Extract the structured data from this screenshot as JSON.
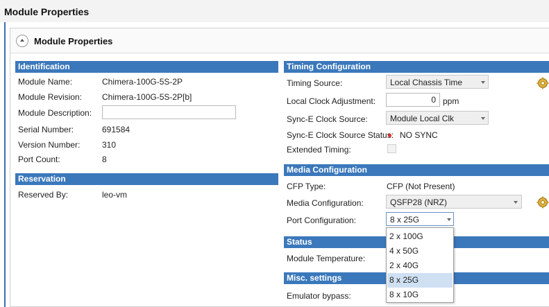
{
  "page_title": "Module Properties",
  "panel_title": "Module Properties",
  "identification": {
    "header": "Identification",
    "module_name": {
      "label": "Module Name:",
      "value": "Chimera-100G-5S-2P"
    },
    "module_revision": {
      "label": "Module Revision:",
      "value": "Chimera-100G-5S-2P[b]"
    },
    "module_description": {
      "label": "Module Description:",
      "value": ""
    },
    "serial_number": {
      "label": "Serial Number:",
      "value": "691584"
    },
    "version_number": {
      "label": "Version Number:",
      "value": "310"
    },
    "port_count": {
      "label": "Port Count:",
      "value": "8"
    }
  },
  "reservation": {
    "header": "Reservation",
    "reserved_by": {
      "label": "Reserved By:",
      "value": "leo-vm"
    }
  },
  "timing": {
    "header": "Timing Configuration",
    "timing_source": {
      "label": "Timing Source:",
      "value": "Local Chassis Time"
    },
    "local_clock_adjustment": {
      "label": "Local Clock Adjustment:",
      "value": "0",
      "unit": "ppm"
    },
    "synce_clock_source": {
      "label": "Sync-E Clock Source:",
      "value": "Module Local Clk"
    },
    "synce_clock_status": {
      "label": "Sync-E Clock Source Status:",
      "value": "NO SYNC"
    },
    "extended_timing": {
      "label": "Extended Timing:",
      "checked": false
    }
  },
  "media": {
    "header": "Media Configuration",
    "cfp_type": {
      "label": "CFP Type:",
      "value": "CFP (Not Present)"
    },
    "media_configuration": {
      "label": "Media Configuration:",
      "value": "QSFP28 (NRZ)"
    },
    "port_configuration": {
      "label": "Port Configuration:",
      "value": "8 x 25G",
      "options": [
        "2 x 100G",
        "4 x 50G",
        "2 x 40G",
        "8 x 25G",
        "8 x 10G"
      ]
    }
  },
  "status": {
    "header": "Status",
    "module_temperature": {
      "label": "Module Temperature:"
    }
  },
  "misc": {
    "header": "Misc. settings",
    "emulator_bypass": {
      "label": "Emulator bypass:"
    }
  },
  "icons": {
    "collapse": "chevron-up-icon",
    "gear": "gear-icon",
    "status_dot_color": "#d9302c"
  }
}
